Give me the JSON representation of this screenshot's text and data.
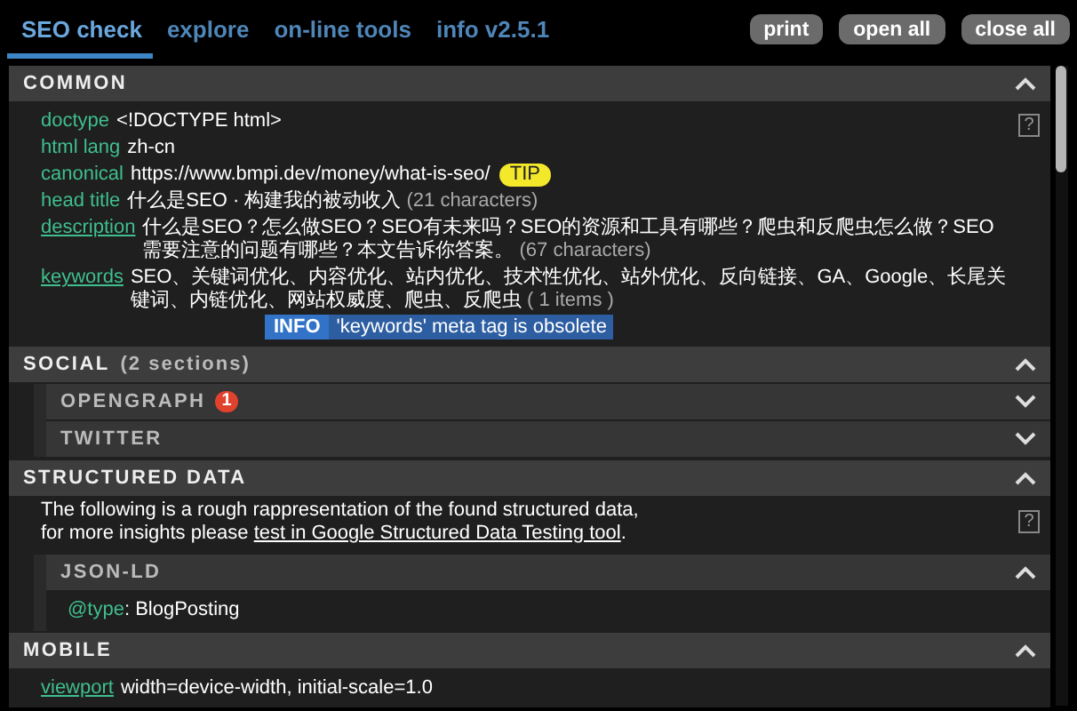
{
  "tabs": [
    {
      "label": "SEO check",
      "selected": true
    },
    {
      "label": "explore",
      "selected": false
    },
    {
      "label": "on-line tools",
      "selected": false
    },
    {
      "label": "info v2.5.1",
      "selected": false
    }
  ],
  "buttons": [
    "print",
    "open all",
    "close all"
  ],
  "sections": [
    {
      "title": "COMMON",
      "expanded": true,
      "help": "?",
      "rows": [
        {
          "kind": "meta",
          "key": "doctype",
          "underlined": false,
          "value": "<!DOCTYPE html>"
        },
        {
          "kind": "meta",
          "key": "html lang",
          "underlined": false,
          "value": "zh-cn"
        },
        {
          "kind": "meta",
          "key": "canonical",
          "underlined": false,
          "value": "https://www.bmpi.dev/money/what-is-seo/",
          "badge": {
            "kind": "tip",
            "label": "TIP"
          }
        },
        {
          "kind": "meta",
          "key": "head title",
          "underlined": false,
          "value": "什么是SEO · 构建我的被动收入",
          "note": "(21 characters)"
        },
        {
          "kind": "meta",
          "key": "description",
          "underlined": true,
          "value": "什么是SEO？怎么做SEO？SEO有未来吗？SEO的资源和工具有哪些？爬虫和反爬虫怎么做？SEO需要注意的问题有哪些？本文告诉你答案。",
          "note": "(67 characters)"
        },
        {
          "kind": "meta",
          "key": "keywords",
          "underlined": true,
          "value": "SEO、关键词优化、内容优化、站内优化、技术性优化、站外优化、反向链接、GA、Google、长尾关键词、内链优化、网站权威度、爬虫、反爬虫",
          "note": "( 1 items )",
          "badge": {
            "kind": "info",
            "label": "INFO",
            "message": "'keywords' meta tag is obsolete"
          }
        }
      ]
    },
    {
      "title": "SOCIAL",
      "subtitle": "(2 sections)",
      "expanded": true,
      "subsections": [
        {
          "title": "OPENGRAPH",
          "count": "1",
          "expanded": false
        },
        {
          "title": "TWITTER",
          "expanded": false
        }
      ]
    },
    {
      "title": "STRUCTURED DATA",
      "expanded": true,
      "help": "?",
      "intro": {
        "text": "The following is a rough rappresentation of the found structured data,\nfor more insights please ",
        "link": "test in Google Structured Data Testing tool",
        "after": "."
      },
      "subsections": [
        {
          "title": "JSON-LD",
          "expanded": true,
          "rows": [
            {
              "kind": "property",
              "key": "@type",
              "underlined": false,
              "value": ": BlogPosting"
            }
          ]
        }
      ]
    },
    {
      "title": "MOBILE",
      "expanded": true,
      "rows": [
        {
          "kind": "meta",
          "key": "viewport",
          "underlined": true,
          "value": "width=device-width, initial-scale=1.0"
        }
      ]
    }
  ]
}
